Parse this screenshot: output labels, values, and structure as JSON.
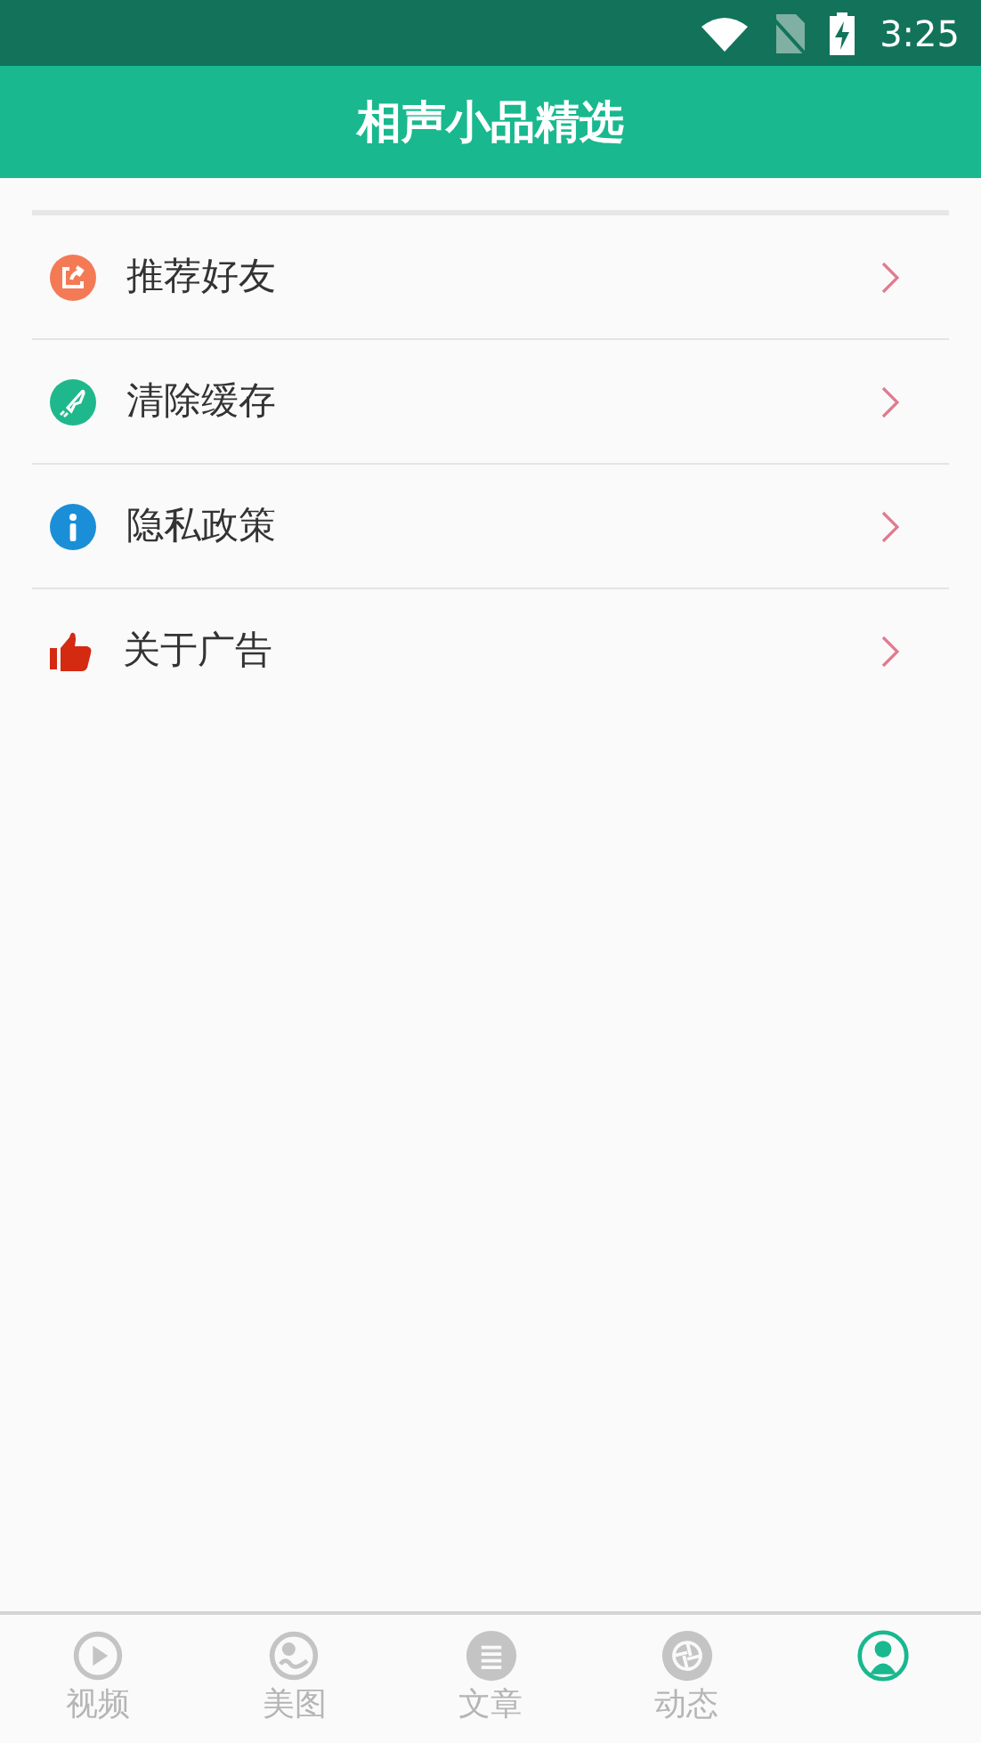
{
  "status_bar": {
    "time": "3:25"
  },
  "header": {
    "title": "相声小品精选"
  },
  "menu": [
    {
      "label": "推荐好友"
    },
    {
      "label": "清除缓存"
    },
    {
      "label": "隐私政策"
    },
    {
      "label": "关于广告"
    }
  ],
  "tabs": [
    {
      "label": "视频",
      "selected": false
    },
    {
      "label": "美图",
      "selected": false
    },
    {
      "label": "文章",
      "selected": false
    },
    {
      "label": "动态",
      "selected": false
    },
    {
      "selected": true
    }
  ]
}
